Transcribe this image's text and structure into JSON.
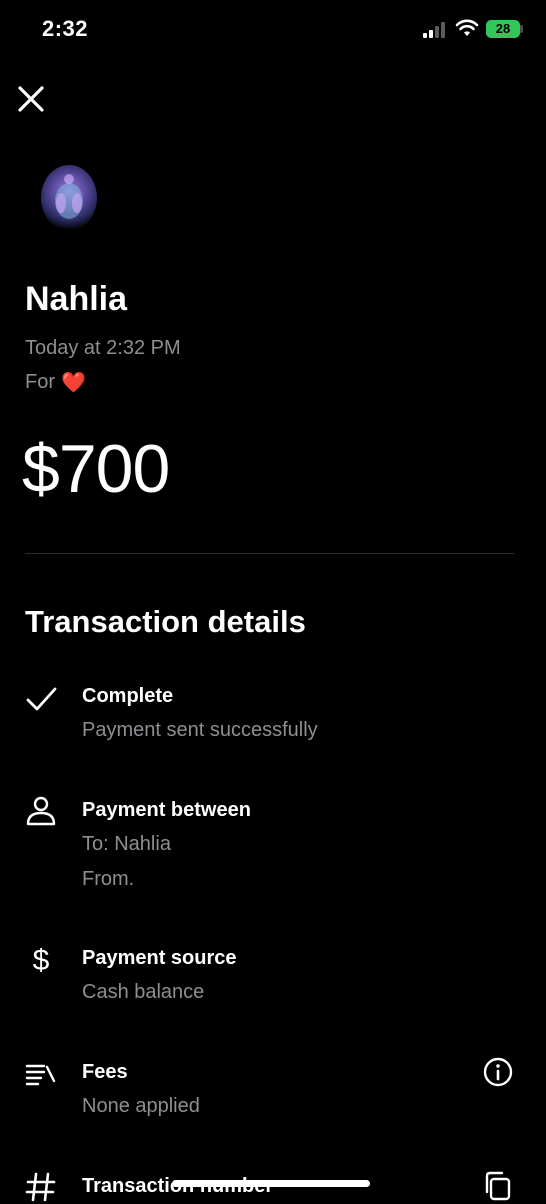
{
  "status_bar": {
    "time": "2:32",
    "battery": "28"
  },
  "header": {
    "recipient": "Nahlia",
    "timestamp": "Today at 2:32 PM",
    "note_prefix": "For",
    "note_emoji": "❤️",
    "amount": "$700"
  },
  "details": {
    "title": "Transaction details",
    "status": {
      "title": "Complete",
      "subtitle": "Payment sent successfully"
    },
    "between": {
      "title": "Payment between",
      "to": "To: Nahlia",
      "from": "From."
    },
    "source": {
      "title": "Payment source",
      "value": "Cash balance"
    },
    "fees": {
      "title": "Fees",
      "value": "None applied"
    },
    "transaction_number": {
      "title": "Transaction number"
    }
  },
  "colors": {
    "background": "#000000",
    "secondary_text": "#8e8e93",
    "battery": "#33c759"
  },
  "icons": {
    "close": "close-icon",
    "status": "checkmark-icon",
    "between": "person-icon",
    "source": "dollar-sign-icon",
    "fees": "fees-list-icon",
    "fees_action": "info-icon",
    "transaction_number": "hash-icon",
    "copy": "copy-icon"
  }
}
